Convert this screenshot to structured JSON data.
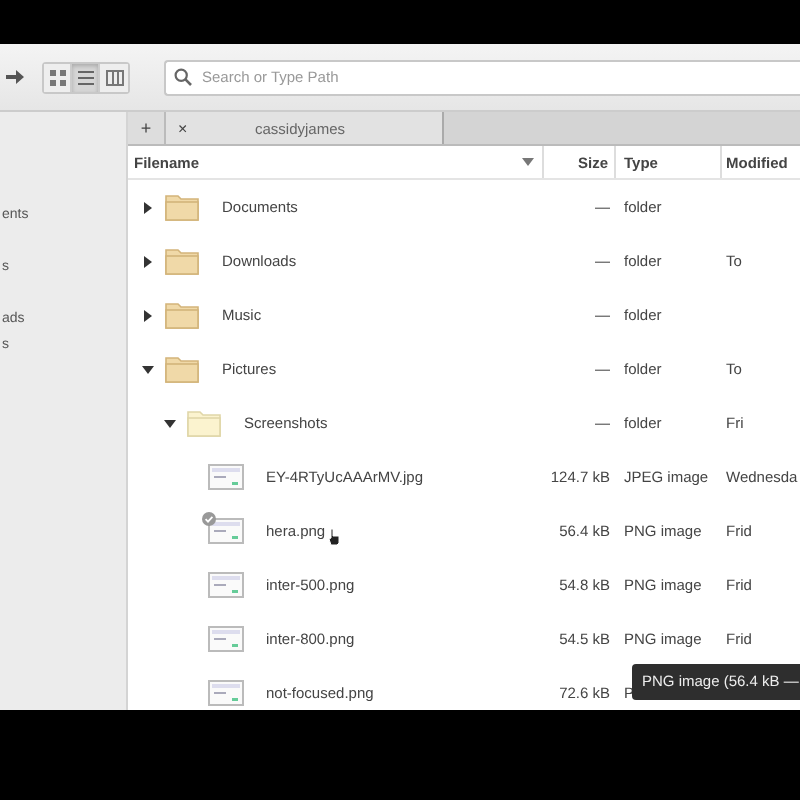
{
  "toolbar": {
    "views": [
      {
        "selected": false
      },
      {
        "selected": true
      },
      {
        "selected": false
      }
    ],
    "search": {
      "placeholder": "Search or Type Path"
    }
  },
  "sidebar": {
    "items": [
      "ents",
      "s",
      "ads",
      "s"
    ]
  },
  "new_tab": "+",
  "tabs": [
    {
      "close": "×",
      "label": "cassidyjames",
      "selected": true
    }
  ],
  "columns": [
    "Filename",
    "Size",
    "Type",
    "Modified"
  ],
  "files": [
    {
      "kind": "folder",
      "name": "Documents",
      "size": "—",
      "type": "folder",
      "expanded": false
    },
    {
      "kind": "folder",
      "name": "Downloads",
      "size": "—",
      "type": "folder",
      "modified": "To",
      "expanded": false
    },
    {
      "kind": "folder",
      "name": "Music",
      "size": "—",
      "type": "folder",
      "expanded": false
    },
    {
      "kind": "folder",
      "name": "Pictures",
      "size": "—",
      "type": "folder",
      "modified": "To",
      "expanded": true,
      "children": [
        {
          "kind": "folder",
          "name": "Screenshots",
          "size": "—",
          "type": "folder",
          "modified": "Fri",
          "expanded": true,
          "children": [
            {
              "kind": "image",
              "name": "EY-4RTyUcAAArMV.jpg",
              "size": "124.7 kB",
              "type": "JPEG image",
              "modified": "Wednesda",
              "hover": false
            },
            {
              "kind": "image",
              "name": "hera.png",
              "size": "56.4 kB",
              "type": "PNG image",
              "modified": "Frid",
              "hover": true
            },
            {
              "kind": "image",
              "name": "inter-500.png",
              "size": "54.8 kB",
              "type": "PNG image",
              "modified": "Frid",
              "hover": false
            },
            {
              "kind": "image",
              "name": "inter-800.png",
              "size": "54.5 kB",
              "type": "PNG image",
              "modified": "Frid",
              "hover": false
            },
            {
              "kind": "image",
              "name": "not-focused.png",
              "size": "72.6 kB",
              "type": "P",
              "hover": false
            }
          ]
        }
      ]
    }
  ],
  "tooltip": "PNG image (56.4 kB —"
}
